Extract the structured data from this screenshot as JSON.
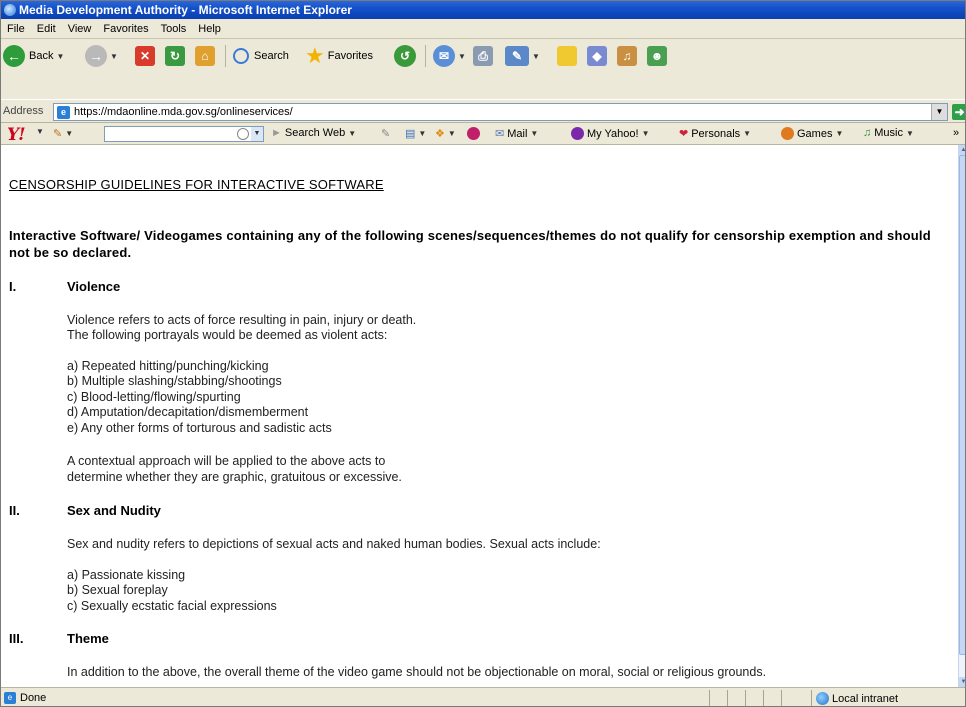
{
  "window": {
    "title": "Media Development Authority - Microsoft Internet Explorer"
  },
  "menu": [
    "File",
    "Edit",
    "View",
    "Favorites",
    "Tools",
    "Help"
  ],
  "toolbar": {
    "back_label": "Back",
    "search_label": "Search",
    "favorites_label": "Favorites"
  },
  "address": {
    "label": "Address",
    "url": "https://mdaonline.mda.gov.sg/onlineservices/"
  },
  "yahoo": {
    "logo": "Y!",
    "search_web": "Search Web",
    "mail": "Mail",
    "my_yahoo": "My Yahoo!",
    "personals": "Personals",
    "games": "Games",
    "music": "Music",
    "overflow": "»"
  },
  "page": {
    "title": "CENSORSHIP GUIDELINES FOR INTERACTIVE SOFTWARE",
    "intro": "Interactive Software/ Videogames containing any of the following scenes/sequences/themes do not qualify for censorship exemption and should not be so declared.",
    "sections": [
      {
        "num": "I.",
        "heading": "Violence",
        "p1a": "Violence refers to acts of force resulting in pain, injury or death.",
        "p1b": "The following portrayals would be deemed as violent acts:",
        "items": [
          "a) Repeated hitting/punching/kicking",
          "b) Multiple slashing/stabbing/shootings",
          "c) Blood-letting/flowing/spurting",
          "d) Amputation/decapitation/dismemberment",
          "e) Any other forms of torturous and sadistic acts"
        ],
        "p2a": "A contextual approach will be applied to the above acts to",
        "p2b": "determine whether they are graphic, gratuitous or excessive."
      },
      {
        "num": "II.",
        "heading": "Sex and Nudity",
        "p1a": "Sex and nudity refers to depictions of sexual acts and naked human bodies. Sexual acts include:",
        "items": [
          "a) Passionate kissing",
          "b) Sexual foreplay",
          "c) Sexually ecstatic facial expressions"
        ]
      },
      {
        "num": "III.",
        "heading": "Theme",
        "p1a": "In addition to the above, the overall theme of the video game should not be objectionable on moral, social or religious grounds."
      }
    ]
  },
  "status": {
    "text": "Done",
    "zone": "Local intranet"
  },
  "colors": {
    "titlebar": "#0a3fb0",
    "chrome": "#ece9d8",
    "yahoo_red": "#d0021b"
  },
  "icons": [
    "ie-icon",
    "back-icon",
    "forward-icon",
    "stop-icon",
    "refresh-icon",
    "home-icon",
    "search-icon",
    "favorites-star-icon",
    "history-icon",
    "mail-icon",
    "print-icon",
    "edit-icon",
    "folder-icon",
    "messenger-icon",
    "page-icon",
    "go-arrow-icon",
    "local-intranet-icon"
  ]
}
